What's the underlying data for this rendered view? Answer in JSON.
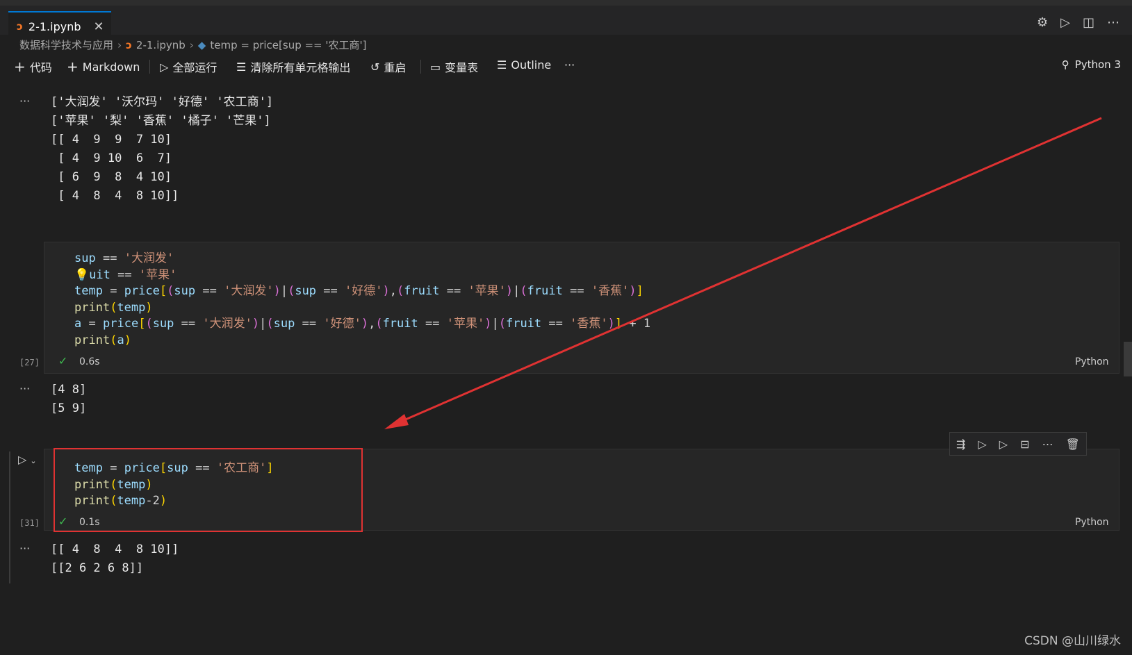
{
  "tab": {
    "filename": "2-1.ipynb",
    "close": "✕"
  },
  "breadcrumb": {
    "folder": "数据科学技术与应用",
    "file": "2-1.ipynb",
    "symbol": "temp = price[sup == '农工商']"
  },
  "toolbar": {
    "code": "代码",
    "markdown": "Markdown",
    "run_all": "全部运行",
    "clear_outputs": "清除所有单元格输出",
    "restart": "重启",
    "variables": "变量表",
    "outline": "Outline",
    "more": "···",
    "kernel": "Python 3"
  },
  "cells": {
    "prev_output": {
      "lines": [
        "['大润发' '沃尔玛' '好德' '农工商']",
        "['苹果' '梨' '香蕉' '橘子' '芒果']",
        "[[ 4  9  9  7 10]",
        " [ 4  9 10  6  7]",
        " [ 6  9  8  4 10]",
        " [ 4  8  4  8 10]]"
      ]
    },
    "cell27": {
      "count": "[27]",
      "time": "0.6s",
      "lang": "Python",
      "output": [
        "[4 8]",
        "[5 9]"
      ]
    },
    "cell31": {
      "count": "[31]",
      "time": "0.1s",
      "lang": "Python",
      "output": [
        "[[ 4  8  4  8 10]]",
        "[[2 6 2 6 8]]"
      ]
    }
  },
  "watermark": "CSDN @山川绿水",
  "colors": {
    "accent": "#0078d4",
    "annotation": "#e03232",
    "success": "#3fb950"
  }
}
